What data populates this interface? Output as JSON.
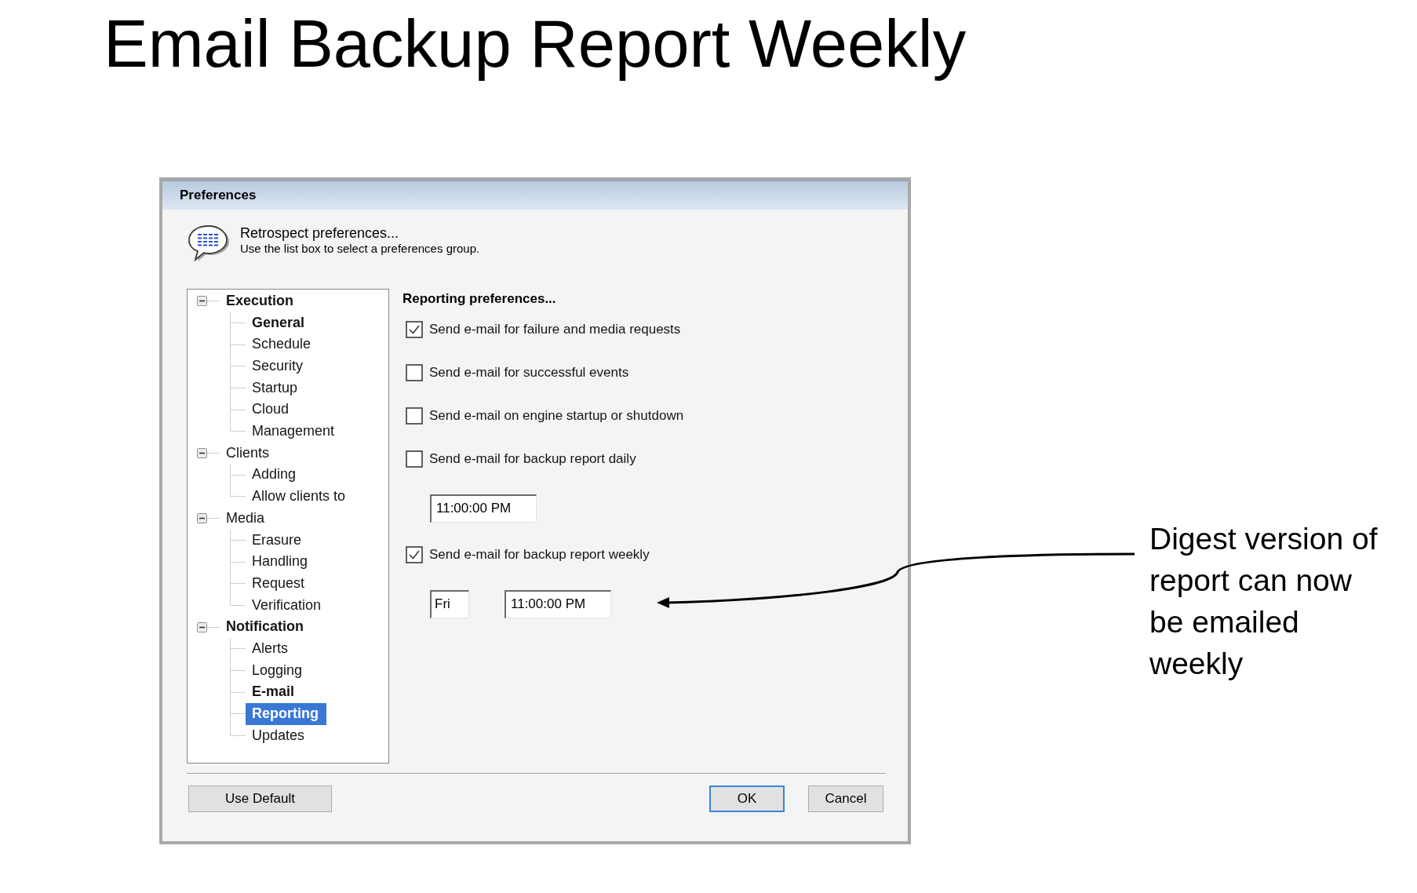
{
  "slide_title": "Email Backup Report Weekly",
  "dialog": {
    "title": "Preferences",
    "header": {
      "heading": "Retrospect preferences...",
      "subheading": "Use the list box to select a preferences group."
    },
    "tree": [
      {
        "label": "Execution",
        "expanded": true,
        "selected": false,
        "emphasized": true,
        "children": [
          {
            "label": "General",
            "selected": false,
            "emphasized": true
          },
          {
            "label": "Schedule",
            "selected": false,
            "emphasized": false
          },
          {
            "label": "Security",
            "selected": false,
            "emphasized": false
          },
          {
            "label": "Startup",
            "selected": false,
            "emphasized": false
          },
          {
            "label": "Cloud",
            "selected": false,
            "emphasized": false
          },
          {
            "label": "Management",
            "selected": false,
            "emphasized": false
          }
        ]
      },
      {
        "label": "Clients",
        "expanded": true,
        "selected": false,
        "emphasized": false,
        "children": [
          {
            "label": "Adding",
            "selected": false,
            "emphasized": false
          },
          {
            "label": "Allow clients to",
            "selected": false,
            "emphasized": false
          }
        ]
      },
      {
        "label": "Media",
        "expanded": true,
        "selected": false,
        "emphasized": false,
        "children": [
          {
            "label": "Erasure",
            "selected": false,
            "emphasized": false
          },
          {
            "label": "Handling",
            "selected": false,
            "emphasized": false
          },
          {
            "label": "Request",
            "selected": false,
            "emphasized": false
          },
          {
            "label": "Verification",
            "selected": false,
            "emphasized": false
          }
        ]
      },
      {
        "label": "Notification",
        "expanded": true,
        "selected": false,
        "emphasized": true,
        "children": [
          {
            "label": "Alerts",
            "selected": false,
            "emphasized": false
          },
          {
            "label": "Logging",
            "selected": false,
            "emphasized": false
          },
          {
            "label": "E-mail",
            "selected": false,
            "emphasized": true
          },
          {
            "label": "Reporting",
            "selected": true,
            "emphasized": true
          },
          {
            "label": "Updates",
            "selected": false,
            "emphasized": false
          }
        ]
      }
    ],
    "panel": {
      "heading": "Reporting preferences...",
      "rows": [
        {
          "kind": "checkbox",
          "label": "Send e-mail for failure and media requests",
          "checked": true
        },
        {
          "kind": "checkbox",
          "label": "Send e-mail for successful events",
          "checked": false
        },
        {
          "kind": "checkbox",
          "label": "Send e-mail on engine startup or shutdown",
          "checked": false
        },
        {
          "kind": "checkbox",
          "label": "Send e-mail for backup report daily",
          "checked": false
        },
        {
          "kind": "fields",
          "fields": [
            {
              "kind": "time",
              "value": "11:00:00 PM"
            }
          ]
        },
        {
          "kind": "checkbox",
          "label": "Send e-mail for backup report weekly",
          "checked": true
        },
        {
          "kind": "fields",
          "fields": [
            {
              "kind": "day",
              "value": "Fri"
            },
            {
              "kind": "time",
              "value": "11:00:00 PM"
            }
          ]
        }
      ]
    },
    "footer": {
      "left_buttons": [
        {
          "label": "Use Default",
          "default": false
        }
      ],
      "right_buttons": [
        {
          "label": "OK",
          "default": true
        },
        {
          "label": "Cancel",
          "default": false
        }
      ]
    }
  },
  "callout": {
    "text": "Digest version of report can now be emailed weekly"
  }
}
